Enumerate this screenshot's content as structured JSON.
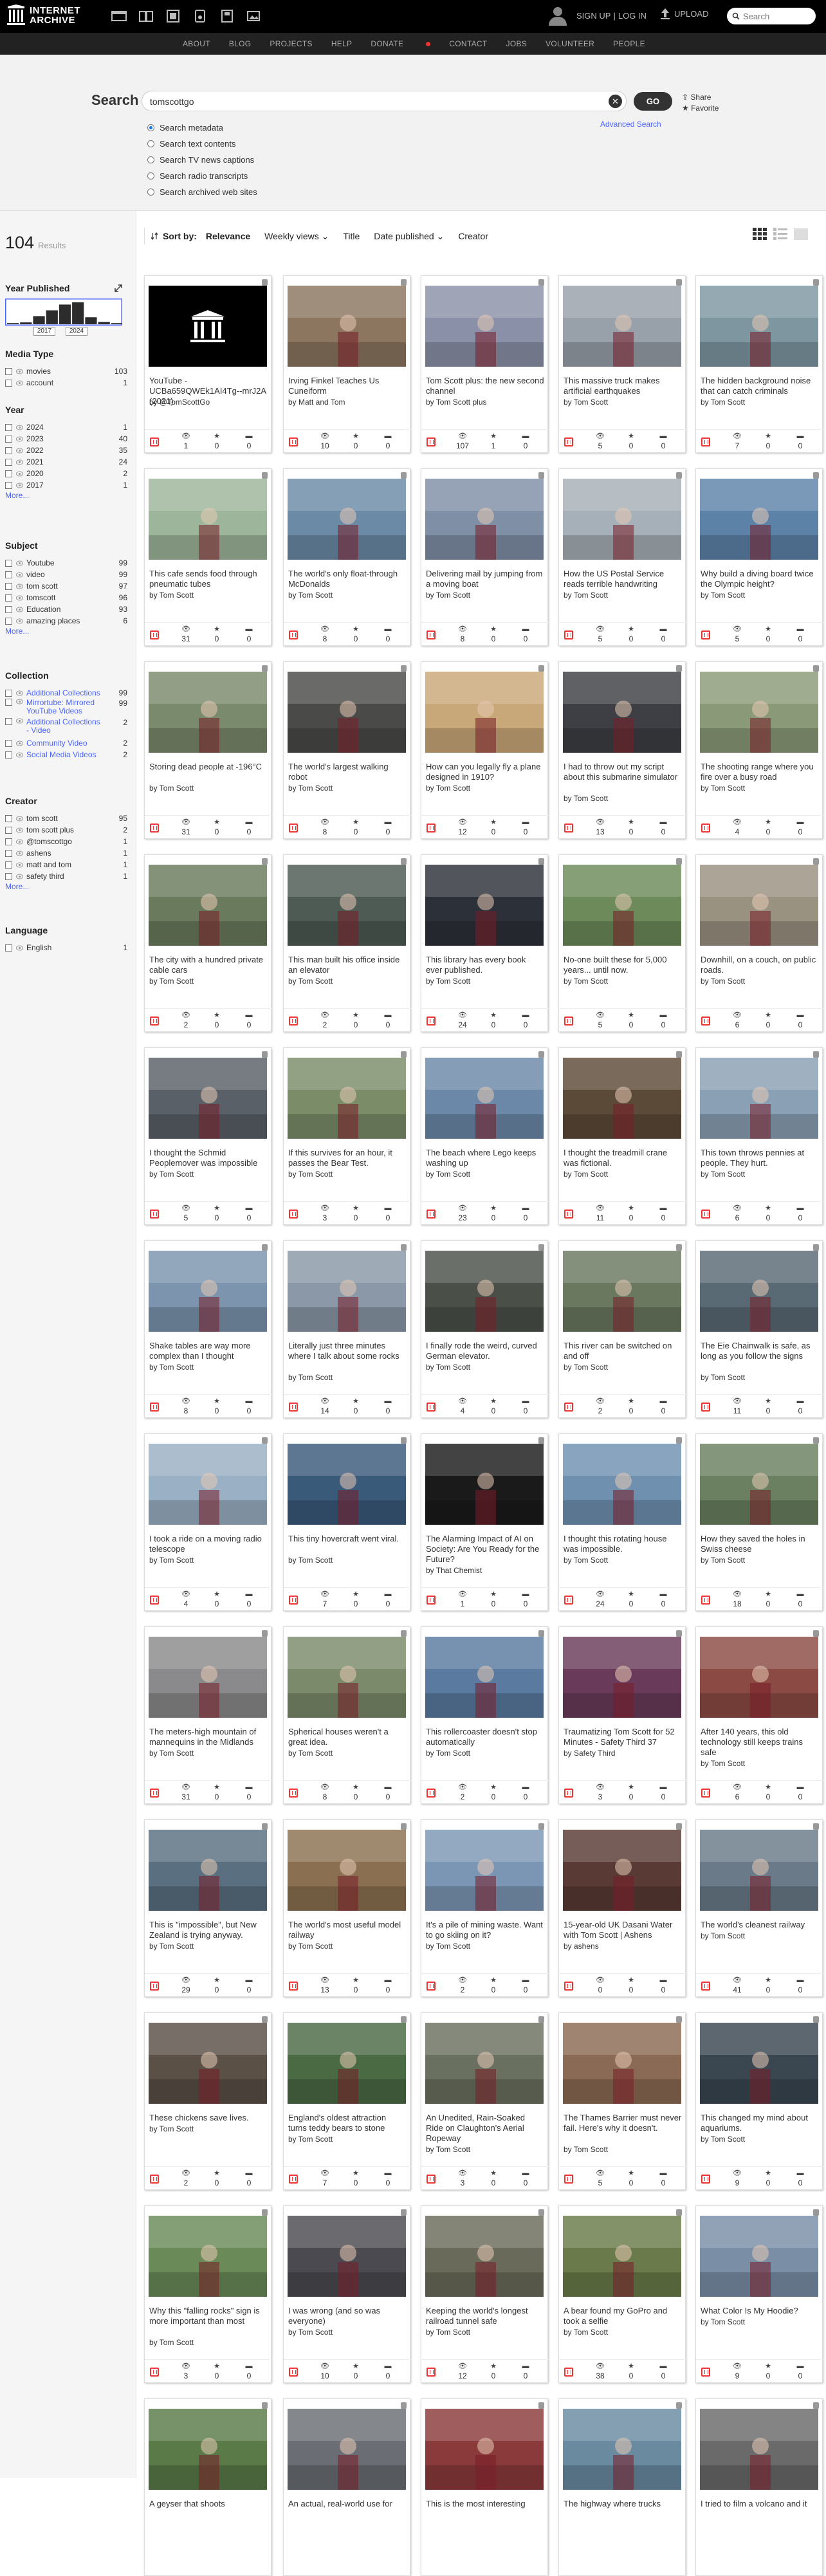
{
  "topbar": {
    "logo_line1": "INTERNET",
    "logo_line2": "ARCHIVE",
    "links": [
      "SIGN UP",
      "|",
      "LOG IN"
    ],
    "upload": "UPLOAD",
    "search_placeholder": "Search",
    "media_icons": [
      "web-icon",
      "texts-icon",
      "video-icon",
      "audio-icon",
      "software-icon",
      "images-icon"
    ]
  },
  "nav": [
    "ABOUT",
    "BLOG",
    "PROJECTS",
    "HELP",
    "DONATE",
    "CONTACT",
    "JOBS",
    "VOLUNTEER",
    "PEOPLE"
  ],
  "search": {
    "label": "Search",
    "value": "tomscottgo",
    "go": "GO",
    "advanced": "Advanced Search",
    "share": "Share",
    "favorite": "Favorite",
    "options": [
      "Search metadata",
      "Search text contents",
      "Search TV news captions",
      "Search radio transcripts",
      "Search archived web sites"
    ],
    "selected": 0
  },
  "results": {
    "count": "104",
    "label": "Results"
  },
  "year_published": {
    "title": "Year Published",
    "from": "2017",
    "to": "2024",
    "histogram": [
      0.05,
      0.08,
      0.35,
      0.6,
      0.85,
      0.95,
      0.3,
      0.1,
      0.05
    ]
  },
  "facets": {
    "media_type": {
      "title": "Media Type",
      "items": [
        {
          "label": "movies",
          "count": "103"
        },
        {
          "label": "account",
          "count": "1"
        }
      ]
    },
    "year": {
      "title": "Year",
      "items": [
        {
          "label": "2024",
          "count": "1"
        },
        {
          "label": "2023",
          "count": "40"
        },
        {
          "label": "2022",
          "count": "35"
        },
        {
          "label": "2021",
          "count": "24"
        },
        {
          "label": "2020",
          "count": "2"
        },
        {
          "label": "2017",
          "count": "1"
        }
      ],
      "more": "More..."
    },
    "subject": {
      "title": "Subject",
      "items": [
        {
          "label": "Youtube",
          "count": "99"
        },
        {
          "label": "video",
          "count": "99"
        },
        {
          "label": "tom scott",
          "count": "97"
        },
        {
          "label": "tomscott",
          "count": "96"
        },
        {
          "label": "Education",
          "count": "93"
        },
        {
          "label": "amazing places",
          "count": "6"
        }
      ],
      "more": "More..."
    },
    "collection": {
      "title": "Collection",
      "items": [
        {
          "label": "Additional Collections",
          "count": "99"
        },
        {
          "label": "Mirrortube: Mirrored YouTube Videos",
          "count": "99"
        },
        {
          "label": "Additional Collections - Video",
          "count": "2"
        },
        {
          "label": "Community Video",
          "count": "2"
        },
        {
          "label": "Social Media Videos",
          "count": "2"
        }
      ]
    },
    "creator": {
      "title": "Creator",
      "items": [
        {
          "label": "tom scott",
          "count": "95"
        },
        {
          "label": "tom scott plus",
          "count": "2"
        },
        {
          "label": "@tomscottgo",
          "count": "1"
        },
        {
          "label": "ashens",
          "count": "1"
        },
        {
          "label": "matt and tom",
          "count": "1"
        },
        {
          "label": "safety third",
          "count": "1"
        }
      ],
      "more": "More..."
    },
    "language": {
      "title": "Language",
      "items": [
        {
          "label": "English",
          "count": "1"
        }
      ]
    }
  },
  "sort": {
    "label": "Sort by:",
    "options": [
      "Relevance",
      "Weekly views",
      "Title",
      "Date published",
      "Creator"
    ],
    "active": 0
  },
  "tiles": [
    {
      "title": "YouTube - UCBa659QWEk1AI4Tg--mrJ2A (2021)",
      "by": "by @TomScottGo",
      "views": "1",
      "favs": "0",
      "reviews": "0",
      "bg": "#000",
      "kind": "logo"
    },
    {
      "title": "Irving Finkel Teaches Us Cuneiform",
      "by": "by Matt and Tom",
      "views": "10",
      "favs": "0",
      "reviews": "0",
      "bg": "#8c7660"
    },
    {
      "title": "Tom Scott plus: the new second channel",
      "by": "by Tom Scott plus",
      "views": "107",
      "favs": "1",
      "reviews": "0",
      "bg": "#8a90a8"
    },
    {
      "title": "This massive truck makes artificial earthquakes",
      "by": "by Tom Scott",
      "views": "5",
      "favs": "0",
      "reviews": "0",
      "bg": "#98a0aa"
    },
    {
      "title": "The hidden background noise that can catch criminals",
      "by": "by Tom Scott",
      "views": "7",
      "favs": "0",
      "reviews": "0",
      "bg": "#7d96a0"
    },
    {
      "title": "This cafe sends food through pneumatic tubes",
      "by": "by Tom Scott",
      "views": "31",
      "favs": "0",
      "reviews": "0",
      "bg": "#9db59a"
    },
    {
      "title": "The world's only float-through McDonalds",
      "by": "by Tom Scott",
      "views": "8",
      "favs": "0",
      "reviews": "0",
      "bg": "#6b8aa6"
    },
    {
      "title": "Delivering mail by jumping from a moving boat",
      "by": "by Tom Scott",
      "views": "8",
      "favs": "0",
      "reviews": "0",
      "bg": "#7f8fa6"
    },
    {
      "title": "How the US Postal Service reads terrible handwriting",
      "by": "by Tom Scott",
      "views": "5",
      "favs": "0",
      "reviews": "0",
      "bg": "#a6b0b8"
    },
    {
      "title": "Why build a diving board twice the Olympic height?",
      "by": "by Tom Scott",
      "views": "5",
      "favs": "0",
      "reviews": "0",
      "bg": "#5d82a8"
    },
    {
      "title": "Storing dead people at -196°C",
      "by": "by Tom Scott",
      "views": "31",
      "favs": "0",
      "reviews": "0",
      "bg": "#7a8a6c"
    },
    {
      "title": "The world's largest walking robot",
      "by": "by Tom Scott",
      "views": "8",
      "favs": "0",
      "reviews": "0",
      "bg": "#4a4a48"
    },
    {
      "title": "How can you legally fly a plane designed in 1910?",
      "by": "by Tom Scott",
      "views": "12",
      "favs": "0",
      "reviews": "0",
      "bg": "#c8a878"
    },
    {
      "title": "I had to throw out my script about this submarine simulator",
      "by": "by Tom Scott",
      "views": "13",
      "favs": "0",
      "reviews": "0",
      "bg": "#3d3f44"
    },
    {
      "title": "The shooting range where you fire over a busy road",
      "by": "by Tom Scott",
      "views": "4",
      "favs": "0",
      "reviews": "0",
      "bg": "#8a9a78"
    },
    {
      "title": "The city with a hundred private cable cars",
      "by": "by Tom Scott",
      "views": "2",
      "favs": "0",
      "reviews": "0",
      "bg": "#6a7a5c"
    },
    {
      "title": "This man built his office inside an elevator",
      "by": "by Tom Scott",
      "views": "2",
      "favs": "0",
      "reviews": "0",
      "bg": "#4e5a54"
    },
    {
      "title": "This library has every book ever published.",
      "by": "by Tom Scott",
      "views": "24",
      "favs": "0",
      "reviews": "0",
      "bg": "#2c3038"
    },
    {
      "title": "No-one built these for 5,000 years... until now.",
      "by": "by Tom Scott",
      "views": "5",
      "favs": "0",
      "reviews": "0",
      "bg": "#6d8a5a"
    },
    {
      "title": "Downhill, on a couch, on public roads.",
      "by": "by Tom Scott",
      "views": "6",
      "favs": "0",
      "reviews": "0",
      "bg": "#9a9280"
    },
    {
      "title": "I thought the Schmid Peoplemover was impossible",
      "by": "by Tom Scott",
      "views": "5",
      "favs": "0",
      "reviews": "0",
      "bg": "#5a6068"
    },
    {
      "title": "If this survives for an hour, it passes the Bear Test.",
      "by": "by Tom Scott",
      "views": "3",
      "favs": "0",
      "reviews": "0",
      "bg": "#7a8c68"
    },
    {
      "title": "The beach where Lego keeps washing up",
      "by": "by Tom Scott",
      "views": "23",
      "favs": "0",
      "reviews": "0",
      "bg": "#6c88a8"
    },
    {
      "title": "I thought the treadmill crane was fictional.",
      "by": "by Tom Scott",
      "views": "11",
      "favs": "0",
      "reviews": "0",
      "bg": "#5c4a38"
    },
    {
      "title": "This town throws pennies at people. They hurt.",
      "by": "by Tom Scott",
      "views": "6",
      "favs": "0",
      "reviews": "0",
      "bg": "#8aa0b4"
    },
    {
      "title": "Shake tables are way more complex than I thought",
      "by": "by Tom Scott",
      "views": "8",
      "favs": "0",
      "reviews": "0",
      "bg": "#7c94ae"
    },
    {
      "title": "Literally just three minutes where I talk about some rocks",
      "by": "by Tom Scott",
      "views": "14",
      "favs": "0",
      "reviews": "0",
      "bg": "#8a98a8"
    },
    {
      "title": "I finally rode the weird, curved German elevator.",
      "by": "by Tom Scott",
      "views": "4",
      "favs": "0",
      "reviews": "0",
      "bg": "#4a5048"
    },
    {
      "title": "This river can be switched on and off",
      "by": "by Tom Scott",
      "views": "2",
      "favs": "0",
      "reviews": "0",
      "bg": "#6a7860"
    },
    {
      "title": "The Eie Chainwalk is safe, as long as you follow the signs",
      "by": "by Tom Scott",
      "views": "11",
      "favs": "0",
      "reviews": "0",
      "bg": "#5a6a74"
    },
    {
      "title": "I took a ride on a moving radio telescope",
      "by": "by Tom Scott",
      "views": "4",
      "favs": "0",
      "reviews": "0",
      "bg": "#9ab0c4"
    },
    {
      "title": "This tiny hovercraft went viral.",
      "by": "by Tom Scott",
      "views": "7",
      "favs": "0",
      "reviews": "0",
      "bg": "#3a5a7a"
    },
    {
      "title": "The Alarming Impact of AI on Society: Are You Ready for the Future?",
      "by": "by That Chemist",
      "views": "1",
      "favs": "0",
      "reviews": "0",
      "bg": "#1a1a1a"
    },
    {
      "title": "I thought this rotating house was impossible.",
      "by": "by Tom Scott",
      "views": "24",
      "favs": "0",
      "reviews": "0",
      "bg": "#7090b0"
    },
    {
      "title": "How they saved the holes in Swiss cheese",
      "by": "by Tom Scott",
      "views": "18",
      "favs": "0",
      "reviews": "0",
      "bg": "#6a8060"
    },
    {
      "title": "The meters-high mountain of mannequins in the Midlands",
      "by": "by Tom Scott",
      "views": "31",
      "favs": "0",
      "reviews": "0",
      "bg": "#8a8a8c"
    },
    {
      "title": "Spherical houses weren't a great idea.",
      "by": "by Tom Scott",
      "views": "8",
      "favs": "0",
      "reviews": "0",
      "bg": "#7a8a6a"
    },
    {
      "title": "This rollercoaster doesn't stop automatically",
      "by": "by Tom Scott",
      "views": "2",
      "favs": "0",
      "reviews": "0",
      "bg": "#5a7aa0"
    },
    {
      "title": "Traumatizing Tom Scott for 52 Minutes - Safety Third 37",
      "by": "by Safety Third",
      "views": "3",
      "favs": "0",
      "reviews": "0",
      "bg": "#6a3a5a"
    },
    {
      "title": "After 140 years, this old technology still keeps trains safe",
      "by": "by Tom Scott",
      "views": "6",
      "favs": "0",
      "reviews": "0",
      "bg": "#8c4a44"
    },
    {
      "title": "This is \"impossible\", but New Zealand is trying anyway.",
      "by": "by Tom Scott",
      "views": "29",
      "favs": "0",
      "reviews": "0",
      "bg": "#5a7080"
    },
    {
      "title": "The world's most useful model railway",
      "by": "by Tom Scott",
      "views": "13",
      "favs": "0",
      "reviews": "0",
      "bg": "#8a7050"
    },
    {
      "title": "It's a pile of mining waste. Want to go skiing on it?",
      "by": "by Tom Scott",
      "views": "2",
      "favs": "0",
      "reviews": "0",
      "bg": "#7a96b4"
    },
    {
      "title": "15-year-old UK Dasani Water with Tom Scott | Ashens",
      "by": "by ashens",
      "views": "0",
      "favs": "0",
      "reviews": "0",
      "bg": "#5a3a34"
    },
    {
      "title": "The world's cleanest railway",
      "by": "by Tom Scott",
      "views": "41",
      "favs": "0",
      "reviews": "0",
      "bg": "#6a7a88"
    },
    {
      "title": "These chickens save lives.",
      "by": "by Tom Scott",
      "views": "2",
      "favs": "0",
      "reviews": "0",
      "bg": "#5a5046"
    },
    {
      "title": "England's oldest attraction turns teddy bears to stone",
      "by": "by Tom Scott",
      "views": "7",
      "favs": "0",
      "reviews": "0",
      "bg": "#4a6a44"
    },
    {
      "title": "An Unedited, Rain-Soaked Ride on Claughton's Aerial Ropeway",
      "by": "by Tom Scott",
      "views": "3",
      "favs": "0",
      "reviews": "0",
      "bg": "#6a7060"
    },
    {
      "title": "The Thames Barrier must never fail. Here's why it doesn't.",
      "by": "by Tom Scott",
      "views": "5",
      "favs": "0",
      "reviews": "0",
      "bg": "#8a6a54"
    },
    {
      "title": "This changed my mind about aquariums.",
      "by": "by Tom Scott",
      "views": "9",
      "favs": "0",
      "reviews": "0",
      "bg": "#3a4650"
    },
    {
      "title": "Why this \"falling rocks\" sign is more important than most",
      "by": "by Tom Scott",
      "views": "3",
      "favs": "0",
      "reviews": "0",
      "bg": "#6a8a58"
    },
    {
      "title": "I was wrong (and so was everyone)",
      "by": "by Tom Scott",
      "views": "10",
      "favs": "0",
      "reviews": "0",
      "bg": "#4a4a50"
    },
    {
      "title": "Keeping the world's longest railroad tunnel safe",
      "by": "by Tom Scott",
      "views": "12",
      "favs": "0",
      "reviews": "0",
      "bg": "#6a6a5a"
    },
    {
      "title": "A bear found my GoPro and took a selfie",
      "by": "by Tom Scott",
      "views": "38",
      "favs": "0",
      "reviews": "0",
      "bg": "#6a7a4a"
    },
    {
      "title": "What Color Is My Hoodie?",
      "by": "by Tom Scott",
      "views": "9",
      "favs": "0",
      "reviews": "0",
      "bg": "#7a8ea6"
    },
    {
      "title": "A geyser that shoots",
      "by": "",
      "views": "",
      "favs": "",
      "reviews": "",
      "bg": "#5a7a48"
    },
    {
      "title": "An actual, real-world use for",
      "by": "",
      "views": "",
      "favs": "",
      "reviews": "",
      "bg": "#6a6e74"
    },
    {
      "title": "This is the most interesting",
      "by": "",
      "views": "",
      "favs": "",
      "reviews": "",
      "bg": "#8a3a3a"
    },
    {
      "title": "The highway where trucks",
      "by": "",
      "views": "",
      "favs": "",
      "reviews": "",
      "bg": "#6a8aa0"
    },
    {
      "title": "I tried to film a volcano and it",
      "by": "",
      "views": "",
      "favs": "",
      "reviews": "",
      "bg": "#6a6a6a"
    }
  ]
}
